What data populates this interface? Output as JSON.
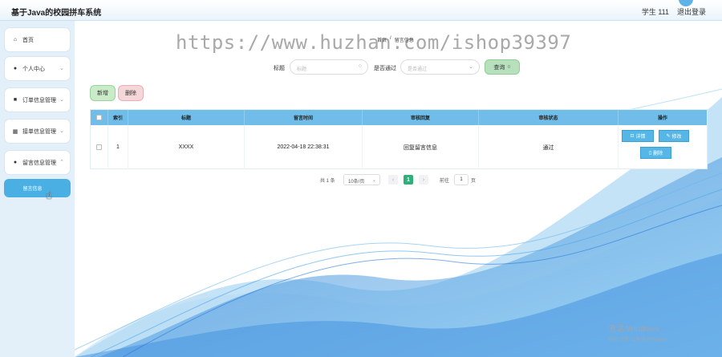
{
  "header": {
    "app_title": "基于Java的校园拼车系统",
    "user": "学生 111",
    "logout": "退出登录"
  },
  "sidebar": {
    "items": [
      {
        "label": "首页",
        "icon": "home-icon"
      },
      {
        "label": "个人中心",
        "icon": "user-icon"
      },
      {
        "label": "订单信息管理",
        "icon": "order-icon"
      },
      {
        "label": "接单信息管理",
        "icon": "grid-icon"
      },
      {
        "label": "留言信息管理",
        "icon": "pin-icon"
      }
    ],
    "active_sub": "留言信息"
  },
  "watermark": "https://www.huzhan.com/ishop39397",
  "breadcrumb": {
    "home": "首页",
    "sep": "/",
    "current": "留言信息"
  },
  "search": {
    "title_label": "标题",
    "title_placeholder": "标题",
    "review_label": "是否通过",
    "review_placeholder": "是否通过",
    "query_button": "查询"
  },
  "actions": {
    "add": "新增",
    "delete": "删除"
  },
  "table": {
    "columns": [
      "索引",
      "标题",
      "留言时间",
      "审核回复",
      "审核状态",
      "操作"
    ],
    "rows": [
      {
        "index": "1",
        "title": "XXXX",
        "time": "2022-04-18 22:38:31",
        "reply": "回复留言信息",
        "status": "通过"
      }
    ],
    "row_buttons": {
      "detail": "详情",
      "edit": "修改",
      "delete": "删除"
    }
  },
  "pagination": {
    "total": "共 1 条",
    "page_size": "10条/页",
    "current_page": "1",
    "goto": "前往",
    "goto_value": "1",
    "page_unit": "页"
  },
  "windows_activation": {
    "line1": "激活 Windows",
    "line2": "转到\"设置\"以激活 Windows。"
  }
}
